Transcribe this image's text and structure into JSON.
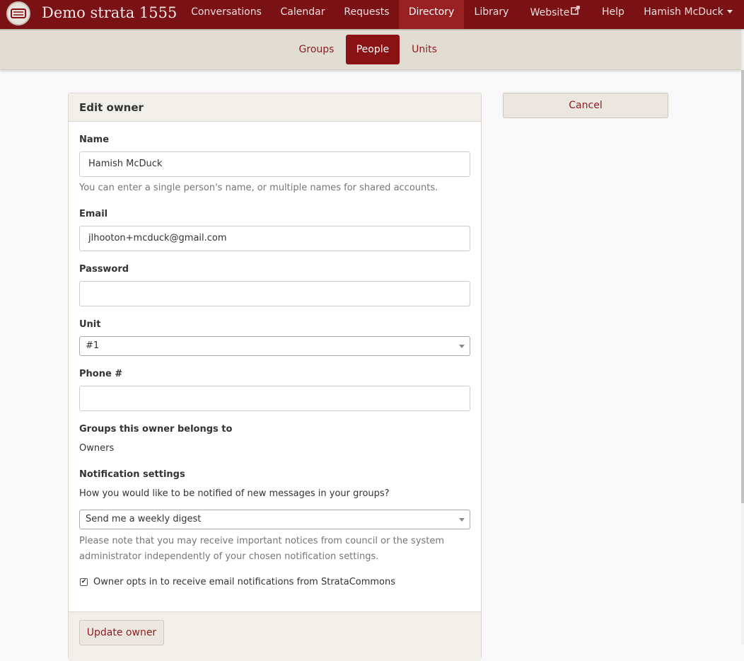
{
  "header": {
    "brand": "Demo strata 1555",
    "nav": [
      {
        "label": "Conversations"
      },
      {
        "label": "Calendar"
      },
      {
        "label": "Requests"
      },
      {
        "label": "Directory",
        "active": true
      },
      {
        "label": "Library"
      },
      {
        "label": "Website",
        "icon": "external-link-icon"
      },
      {
        "label": "Help"
      }
    ],
    "user": "Hamish McDuck"
  },
  "subnav": {
    "tabs": [
      {
        "label": "Groups"
      },
      {
        "label": "People",
        "active": true
      },
      {
        "label": "Units"
      }
    ]
  },
  "form": {
    "title": "Edit owner",
    "name_label": "Name",
    "name_value": "Hamish McDuck",
    "name_help": "You can enter a single person's name, or multiple names for shared accounts.",
    "email_label": "Email",
    "email_value": "jlhooton+mcduck@gmail.com",
    "password_label": "Password",
    "password_value": "",
    "unit_label": "Unit",
    "unit_value": "#1",
    "phone_label": "Phone #",
    "phone_value": "",
    "groups_label": "Groups this owner belongs to",
    "groups_value": "Owners",
    "notif_label": "Notification settings",
    "notif_question": "How you would like to be notified of new messages in your groups?",
    "notif_value": "Send me a weekly digest",
    "notif_help": "Please note that you may receive important notices from council or the system administrator independently of your chosen notification settings.",
    "optin_label": "Owner opts in to receive email notifications from StrataCommons",
    "optin_checked": true,
    "submit_label": "Update owner"
  },
  "side": {
    "cancel_label": "Cancel"
  },
  "colors": {
    "primary": "#7a1114",
    "active_nav": "#981f22",
    "subnav_bg": "#e2ddd2",
    "link": "#8c1b1e"
  }
}
